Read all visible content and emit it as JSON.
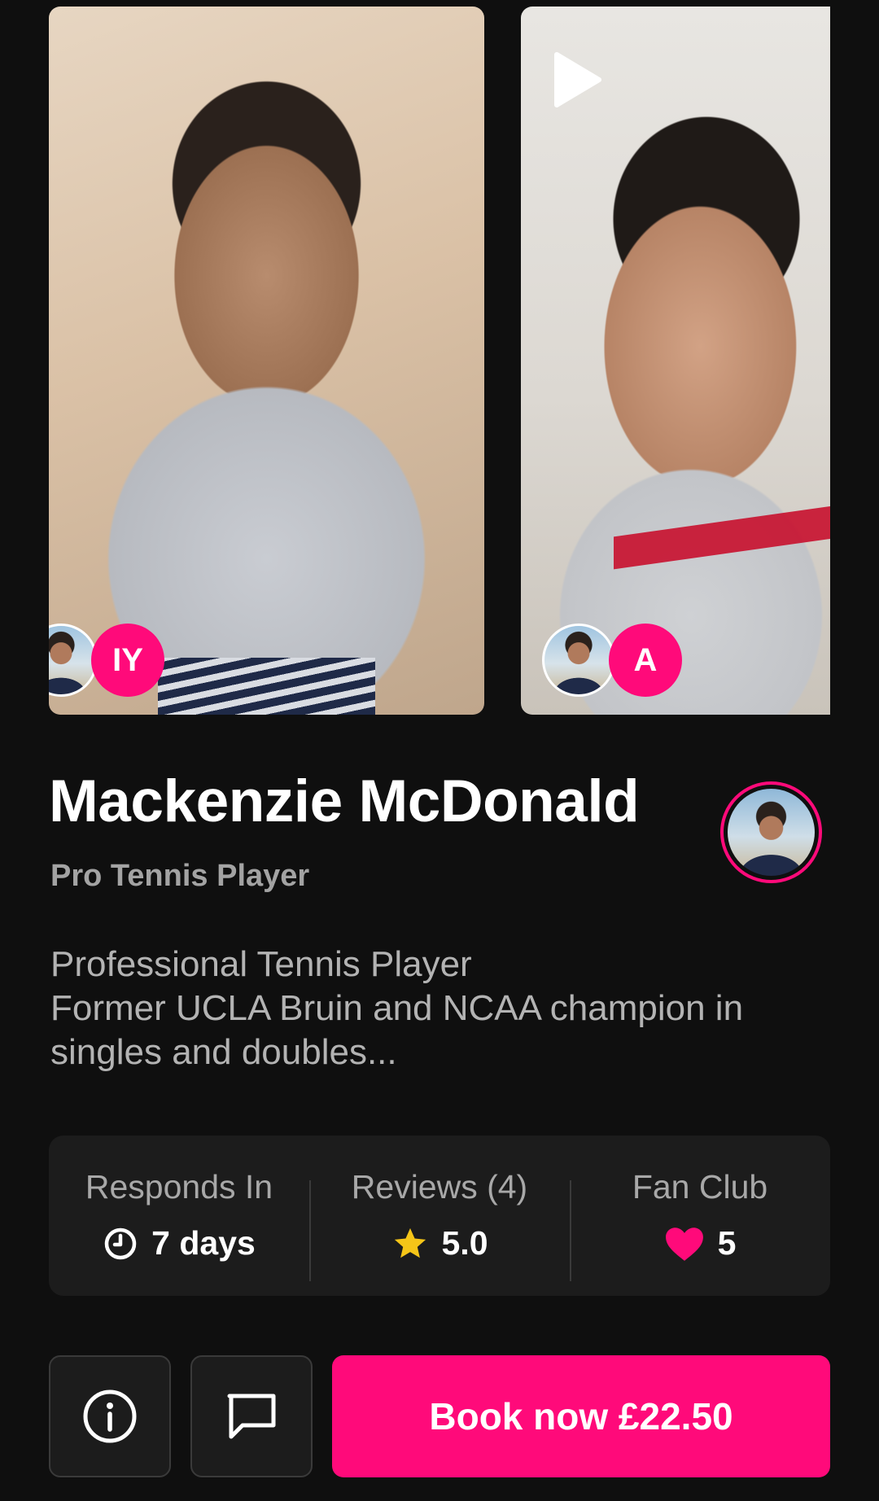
{
  "videos": [
    {
      "initials": "IY",
      "has_play": false
    },
    {
      "initials": "A",
      "has_play": true
    }
  ],
  "profile": {
    "name": "Mackenzie McDonald",
    "category": "Pro Tennis Player",
    "bio_lines": [
      "Professional Tennis Player",
      "Former UCLA Bruin and NCAA champion in",
      "singles and doubles..."
    ]
  },
  "stats": {
    "responds": {
      "label": "Responds In",
      "value": "7 days",
      "icon": "clock-icon"
    },
    "reviews": {
      "label": "Reviews (4)",
      "value": "5.0",
      "icon": "star-icon"
    },
    "fan_club": {
      "label": "Fan Club",
      "value": "5",
      "icon": "heart-icon"
    }
  },
  "actions": {
    "info_icon": "info-icon",
    "message_icon": "message-icon",
    "book_label": "Book now £22.50"
  },
  "colors": {
    "accent": "#ff0a7a",
    "background": "#0f0f0f",
    "card": "#1c1c1c",
    "star": "#f5c518"
  }
}
